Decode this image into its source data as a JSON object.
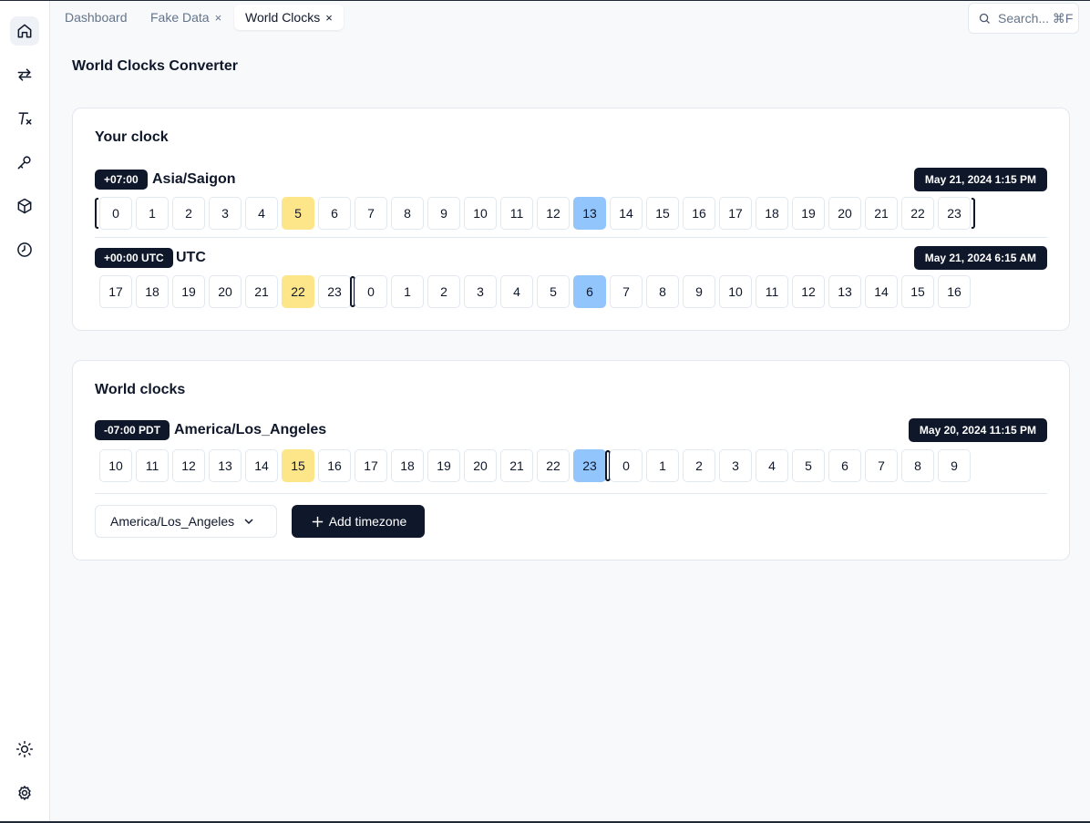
{
  "tabs": [
    {
      "label": "Dashboard",
      "closable": false
    },
    {
      "label": "Fake Data",
      "closable": true
    },
    {
      "label": "World Clocks",
      "closable": true,
      "active": true
    }
  ],
  "tab_close_glyph": "×",
  "search": {
    "placeholder": "Search... ⌘F"
  },
  "sidebar": {
    "top_icons": [
      "home-icon",
      "arrows-swap-icon",
      "clear-format-icon",
      "key-icon",
      "package-icon",
      "clock-icon"
    ],
    "bottom_icons": [
      "sun-icon",
      "settings-icon"
    ]
  },
  "page_title": "World Clocks Converter",
  "your_clock": {
    "title": "Your clock",
    "zones": [
      {
        "offset": "+07:00",
        "name": "Asia/Saigon",
        "datetime": "May 21, 2024 1:15 PM",
        "hours": [
          0,
          1,
          2,
          3,
          4,
          5,
          6,
          7,
          8,
          9,
          10,
          11,
          12,
          13,
          14,
          15,
          16,
          17,
          18,
          19,
          20,
          21,
          22,
          23
        ],
        "current_hour": 5,
        "selected_hour": 13
      },
      {
        "offset": "+00:00 UTC",
        "name": "UTC",
        "datetime": "May 21, 2024 6:15 AM",
        "hours": [
          17,
          18,
          19,
          20,
          21,
          22,
          23,
          0,
          1,
          2,
          3,
          4,
          5,
          6,
          7,
          8,
          9,
          10,
          11,
          12,
          13,
          14,
          15,
          16
        ],
        "current_hour": 22,
        "selected_hour": 6
      }
    ]
  },
  "world_clocks": {
    "title": "World clocks",
    "zones": [
      {
        "offset": "-07:00 PDT",
        "name": "America/Los_Angeles",
        "datetime": "May 20, 2024 11:15 PM",
        "hours": [
          10,
          11,
          12,
          13,
          14,
          15,
          16,
          17,
          18,
          19,
          20,
          21,
          22,
          23,
          0,
          1,
          2,
          3,
          4,
          5,
          6,
          7,
          8,
          9
        ],
        "current_hour": 15,
        "selected_hour": 23
      }
    ],
    "select_value": "America/Los_Angeles",
    "add_button_label": "Add timezone"
  },
  "colors": {
    "accent_dark": "#0f172a",
    "current_hour": "#fde68a",
    "selected_hour": "#93c5fd"
  }
}
